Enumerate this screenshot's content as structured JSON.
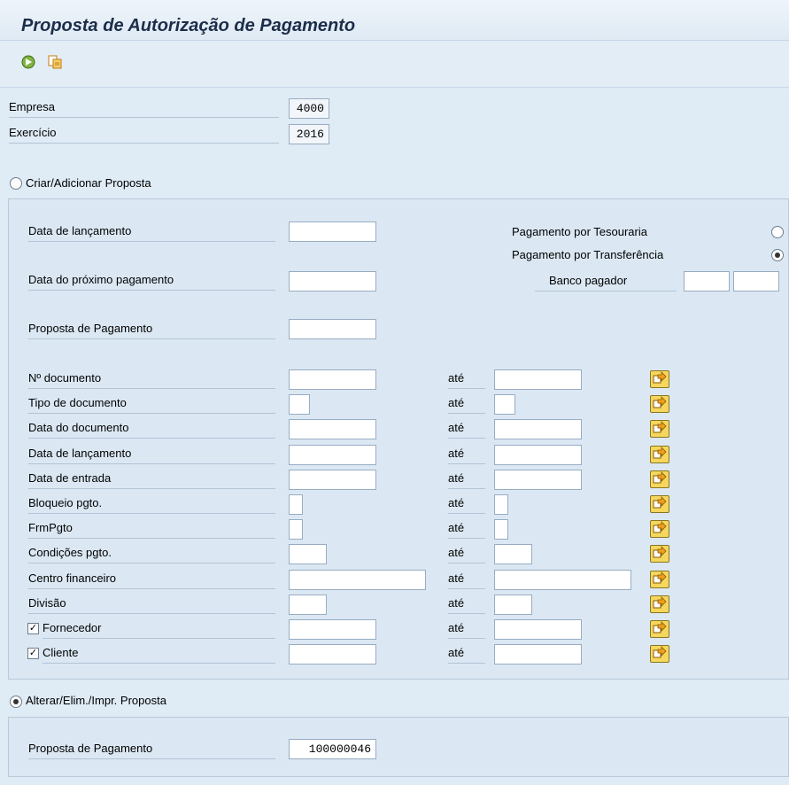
{
  "title": "Proposta de Autorização de Pagamento",
  "toolbar": {
    "execute_icon": "execute-icon",
    "variant_icon": "get-variant-icon"
  },
  "header_fields": {
    "empresa": {
      "label": "Empresa",
      "value": "4000"
    },
    "exercicio": {
      "label": "Exercício",
      "value": "2016"
    }
  },
  "section_create": {
    "radio_label": "Criar/Adicionar Proposta",
    "selected": false,
    "data_lancamento_label": "Data de lançamento",
    "data_proximo_pagamento_label": "Data do próximo pagamento",
    "proposta_pagamento_label": "Proposta de Pagamento",
    "pag_tesouraria_label": "Pagamento por Tesouraria",
    "pag_transferencia_label": "Pagamento por Transferência",
    "banco_pagador_label": "Banco pagador",
    "ranges": [
      {
        "label": "Nº documento",
        "to": "até"
      },
      {
        "label": "Tipo de documento",
        "to": "até"
      },
      {
        "label": "Data do documento",
        "to": "até"
      },
      {
        "label": "Data de lançamento",
        "to": "até"
      },
      {
        "label": "Data de entrada",
        "to": "até"
      },
      {
        "label": "Bloqueio pgto.",
        "to": "até"
      },
      {
        "label": "FrmPgto",
        "to": "até"
      },
      {
        "label": "Condições pgto.",
        "to": "até"
      },
      {
        "label": "Centro financeiro",
        "to": "até"
      },
      {
        "label": "Divisão",
        "to": "até"
      },
      {
        "label": "Fornecedor",
        "to": "até",
        "checked": true
      },
      {
        "label": "Cliente",
        "to": "até",
        "checked": true
      }
    ],
    "multi_select_icon": "multiple-selection-icon"
  },
  "section_change": {
    "radio_label": "Alterar/Elim./Impr. Proposta",
    "selected": true,
    "proposta_pagamento_label": "Proposta de Pagamento",
    "proposta_pagamento_value": "100000046"
  }
}
